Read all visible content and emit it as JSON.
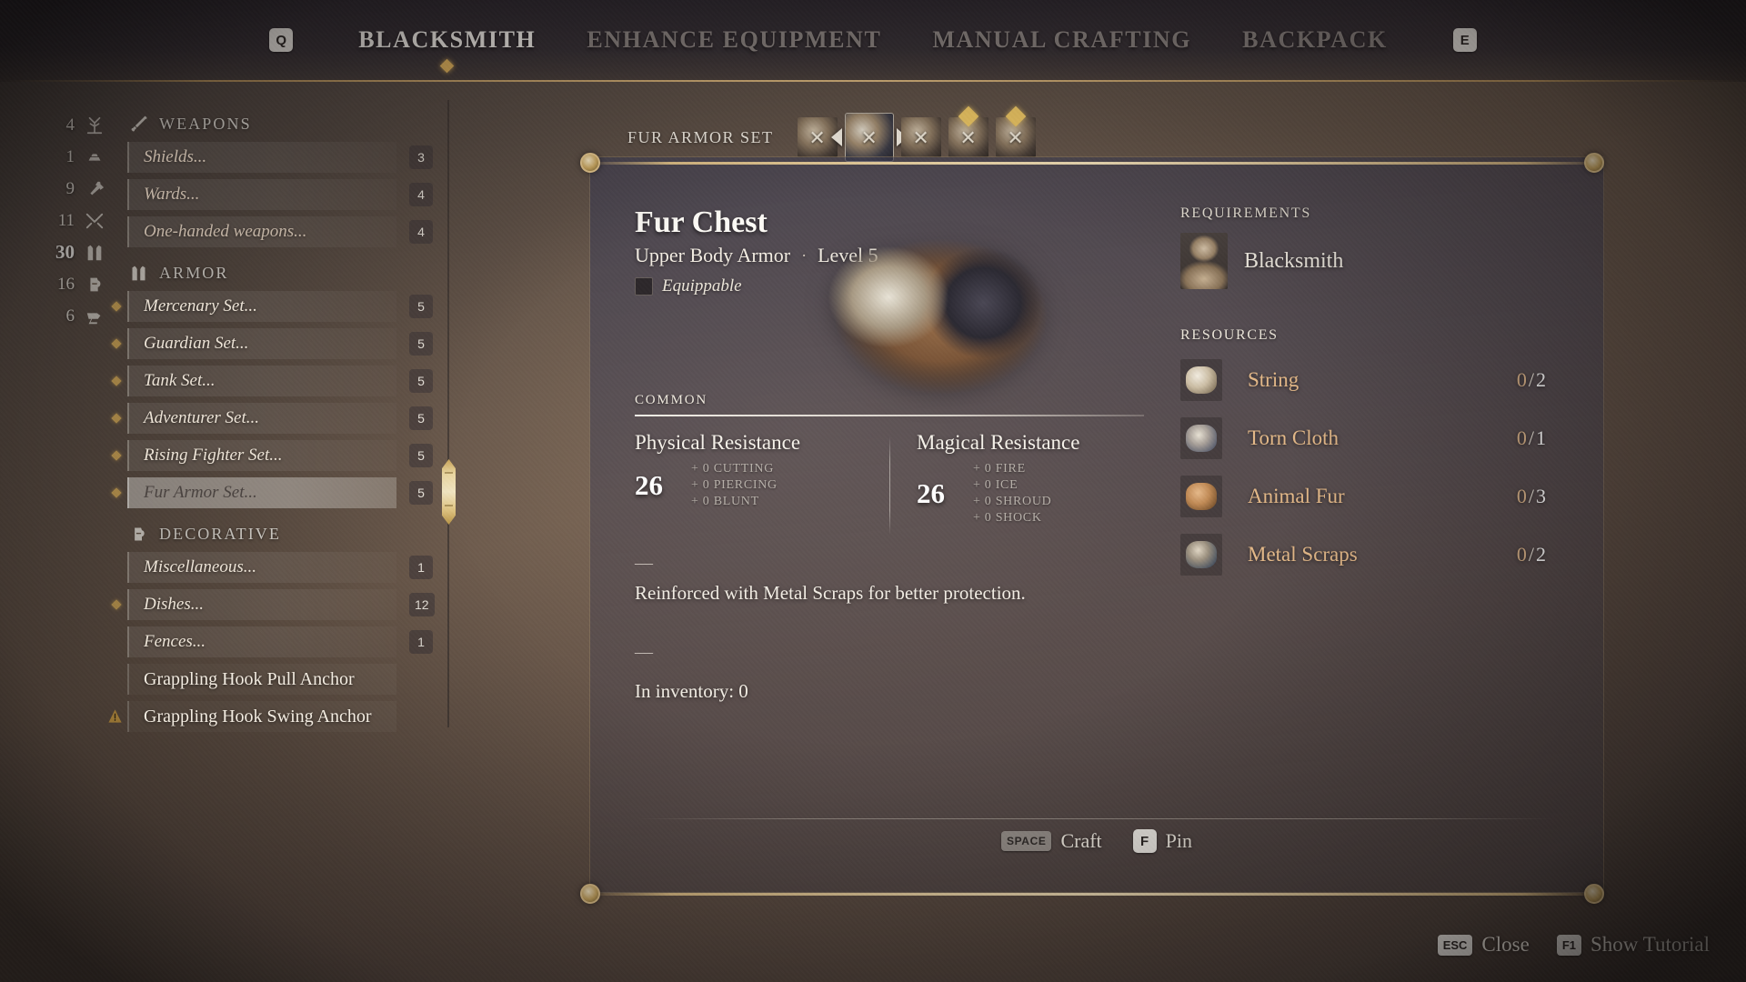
{
  "nav": {
    "left_key": "Q",
    "right_key": "E",
    "tabs": [
      {
        "label": "BLACKSMITH",
        "active": true
      },
      {
        "label": "ENHANCE EQUIPMENT",
        "active": false
      },
      {
        "label": "MANUAL CRAFTING",
        "active": false
      },
      {
        "label": "BACKPACK",
        "active": false
      }
    ]
  },
  "counters": [
    {
      "value": "4",
      "icon": "plant-icon"
    },
    {
      "value": "1",
      "icon": "ingots-icon"
    },
    {
      "value": "9",
      "icon": "torch-icon"
    },
    {
      "value": "11",
      "icon": "swords-icon"
    },
    {
      "value": "30",
      "icon": "armor-icon",
      "highlight": true
    },
    {
      "value": "16",
      "icon": "jug-icon"
    },
    {
      "value": "6",
      "icon": "anvil-icon"
    }
  ],
  "sidebar": {
    "groups": [
      {
        "icon": "sword-icon",
        "title": "WEAPONS",
        "items": [
          {
            "label": "Shields...",
            "count": "3",
            "bullet": false,
            "selected": false,
            "dim": true
          },
          {
            "label": "Wards...",
            "count": "4",
            "bullet": false,
            "selected": false,
            "dim": true
          },
          {
            "label": "One-handed weapons...",
            "count": "4",
            "bullet": false,
            "selected": false,
            "dim": true
          }
        ]
      },
      {
        "icon": "armor-icon",
        "title": "ARMOR",
        "items": [
          {
            "label": "Mercenary Set...",
            "count": "5",
            "bullet": true,
            "selected": false
          },
          {
            "label": "Guardian Set...",
            "count": "5",
            "bullet": true,
            "selected": false
          },
          {
            "label": "Tank Set...",
            "count": "5",
            "bullet": true,
            "selected": false
          },
          {
            "label": "Adventurer Set...",
            "count": "5",
            "bullet": true,
            "selected": false
          },
          {
            "label": "Rising Fighter Set...",
            "count": "5",
            "bullet": true,
            "selected": false
          },
          {
            "label": "Fur Armor Set...",
            "count": "5",
            "bullet": true,
            "selected": true
          }
        ]
      },
      {
        "icon": "jug-icon",
        "title": "DECORATIVE",
        "items": [
          {
            "label": "Miscellaneous...",
            "count": "1",
            "bullet": false,
            "selected": false
          },
          {
            "label": "Dishes...",
            "count": "12",
            "bullet": true,
            "selected": false
          },
          {
            "label": "Fences...",
            "count": "1",
            "bullet": false,
            "selected": false
          },
          {
            "label": "Grappling Hook Pull Anchor",
            "count": "",
            "bullet": false,
            "selected": false,
            "plain": true
          },
          {
            "label": "Grappling Hook Swing Anchor",
            "count": "",
            "bullet": false,
            "selected": false,
            "plain": true,
            "warn": true
          }
        ]
      }
    ]
  },
  "set_strip": {
    "set_name": "FUR ARMOR SET",
    "slots": [
      {
        "name": "fur-hood-slot",
        "current": false,
        "locked": true,
        "gold_marker": false
      },
      {
        "name": "fur-chest-slot",
        "current": true,
        "locked": true,
        "gold_marker": false
      },
      {
        "name": "fur-gloves-slot",
        "current": false,
        "locked": true,
        "gold_marker": false
      },
      {
        "name": "fur-trousers-slot",
        "current": false,
        "locked": true,
        "gold_marker": true
      },
      {
        "name": "fur-boots-slot",
        "current": false,
        "locked": true,
        "gold_marker": true
      }
    ]
  },
  "item": {
    "title": "Fur Chest",
    "type": "Upper Body Armor",
    "separator": "·",
    "level": "Level 5",
    "equippable": "Equippable",
    "rarity": "COMMON",
    "stats": [
      {
        "name": "Physical Resistance",
        "value": "26",
        "subs": [
          "+ 0 CUTTING",
          "+ 0 PIERCING",
          "+ 0 BLUNT"
        ]
      },
      {
        "name": "Magical Resistance",
        "value": "26",
        "subs": [
          "+ 0 FIRE",
          "+ 0 ICE",
          "+ 0 SHROUD",
          "+ 0 SHOCK"
        ]
      }
    ],
    "dash": "—",
    "description": "Reinforced with Metal Scraps for better protection.",
    "in_inventory": "In inventory: 0"
  },
  "requirements": {
    "heading": "REQUIREMENTS",
    "entries": [
      {
        "name": "Blacksmith",
        "icon": "blacksmith-portrait"
      }
    ]
  },
  "resources": {
    "heading": "RESOURCES",
    "entries": [
      {
        "name": "String",
        "icon": "string-icon",
        "have": "0",
        "sep": "/",
        "need": "2"
      },
      {
        "name": "Torn Cloth",
        "icon": "cloth-icon",
        "have": "0",
        "sep": "/",
        "need": "1"
      },
      {
        "name": "Animal Fur",
        "icon": "fur-icon",
        "have": "0",
        "sep": "/",
        "need": "3"
      },
      {
        "name": "Metal Scraps",
        "icon": "metal-icon",
        "have": "0",
        "sep": "/",
        "need": "2"
      }
    ]
  },
  "panel_actions": [
    {
      "key": "SPACE",
      "label": "Craft",
      "wide": true
    },
    {
      "key": "F",
      "label": "Pin",
      "wide": false
    }
  ],
  "hints": [
    {
      "key": "ESC",
      "label": "Close"
    },
    {
      "key": "F1",
      "label": "Show Tutorial"
    }
  ],
  "colors": {
    "accent_gold": "#e2b45c",
    "resource_name": "#e3b888",
    "text_primary": "#f4f1ec"
  }
}
